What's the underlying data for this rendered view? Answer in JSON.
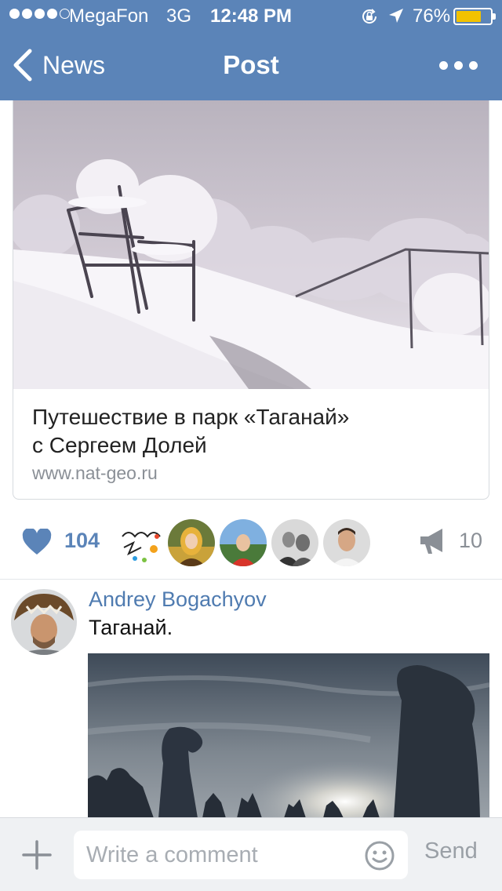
{
  "status_bar": {
    "signal_bars_filled": 4,
    "signal_bars_total": 5,
    "carrier": "MegaFon",
    "network": "3G",
    "time": "12:48 PM",
    "battery_percent": "76%",
    "battery_level": 0.76,
    "icons": [
      "orientation-lock-icon",
      "location-arrow-icon",
      "battery-icon"
    ]
  },
  "nav": {
    "back_label": "News",
    "title": "Post",
    "more_icon": "ellipsis-icon"
  },
  "link_card": {
    "title_line1": "Путешествие в парк «Таганай»",
    "title_line2": "с Сергеем Долей",
    "domain": "www.nat-geo.ru"
  },
  "reactions": {
    "likes": "104",
    "shares": "10",
    "liked_by_avatars": 5
  },
  "comment": {
    "author": "Andrey Bogachyov",
    "text": "Таганай."
  },
  "composer": {
    "placeholder": "Write a comment",
    "send_label": "Send"
  },
  "colors": {
    "accent": "#5b84b8",
    "link_blue": "#4f7bb0",
    "battery_yellow": "#f2c200",
    "muted": "#8a8f96"
  }
}
